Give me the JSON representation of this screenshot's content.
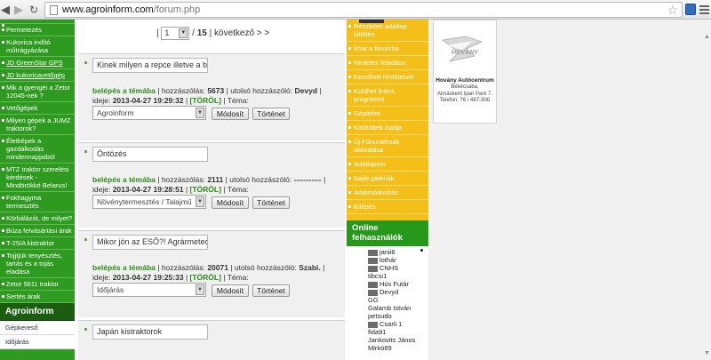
{
  "browser": {
    "url_domain": "www.agroinform.com",
    "url_path": "/forum.php"
  },
  "left_menu": {
    "items": [
      "Permetezés",
      "Kukorica indító műtrágyázása",
      "JD GreenStar GPS",
      "JD kukoricavetőgép",
      "Mik a gyengéi a Zetor 12045-nek ?",
      "Vetőgépek",
      "Milyen gépek a JUMZ traktorok?",
      "Életképek a gazdálkodás mindennapjaiból",
      "MTZ traktor szerelési kérdések - Mindörökké Belarus!",
      "Fokhagyma termesztés",
      "Körbálázót, de milyet?",
      "Búza felvásártási árak",
      "T-25/A kistraktor",
      "Tojjtjük tenyésztés, tartás és a tojás eladása",
      "Zetor 5611 traktor",
      "Sertés árak"
    ],
    "underlined": [
      "JD GreenStar GPS",
      "JD kukoricavetőgép"
    ],
    "section_title": "Agroinform",
    "sub_items": [
      "Gépkereső",
      "Időjárás"
    ]
  },
  "pager": {
    "page": "1",
    "total": "15",
    "next_label": "következő > >"
  },
  "topics": [
    {
      "title": "Kinek milyen a repce illetve a bú",
      "join": "belépés a témába",
      "replies_label": "hozzászólás:",
      "replies": "5673",
      "last_label": "utolsó hozzászóló:",
      "last_user": "Devyd",
      "date_label": "ideje:",
      "date": "2013-04-27 19:29:32",
      "delete": "[TÖRÖL]",
      "theme_label": "Téma:",
      "category": "Agroinform",
      "modify": "Módosít",
      "history": "Történet"
    },
    {
      "title": "Öntözés",
      "join": "belépés a témába",
      "replies_label": "hozzászólás:",
      "replies": "2111",
      "last_label": "utolsó hozzászóló:",
      "last_user": "-----------",
      "date_label": "ideje:",
      "date": "2013-04-27 19:28:51",
      "delete": "[TÖRÖL]",
      "theme_label": "Téma:",
      "category": "Növénytermesztés / Talajmű",
      "modify": "Módosít",
      "history": "Történet"
    },
    {
      "title": "Mikor jön az ESŐ?! Agrármeteon",
      "join": "belépés a témába",
      "replies_label": "hozzászólás:",
      "replies": "20071",
      "last_label": "utolsó hozzászóló:",
      "last_user": "Szabi.",
      "date_label": "ideje:",
      "date": "2013-04-27 19:25:33",
      "delete": "[TÖRÖL]",
      "theme_label": "Téma:",
      "category": "Időjárás",
      "modify": "Módosít",
      "history": "Történet"
    },
    {
      "title": "Japán kistraktorok"
    }
  ],
  "right_menu": {
    "items": [
      "Részletes adatlap kitöltés",
      "Írhat a fórumba",
      "Hirdetés feladása",
      "Kezelheti hirdetéseit",
      "Küldhet linket, programot",
      "Gépitélet",
      "Kitöltöttek listája",
      "Új Fórumtémák aktiválása",
      "Adatlapom",
      "Saját galériák",
      "Adatmódosítás",
      "Kilépés"
    ],
    "online_title": "Online felhasználók",
    "online_users": [
      {
        "name": "janii6",
        "avatar": true
      },
      {
        "name": "lothár",
        "avatar": true
      },
      {
        "name": "CNHS",
        "avatar": true
      },
      {
        "name": "tibcsi1",
        "avatar": false
      },
      {
        "name": "Hús Futár",
        "avatar": true
      },
      {
        "name": "Devyd",
        "avatar": true
      },
      {
        "name": "GG",
        "avatar": false
      },
      {
        "name": "Galamb István",
        "avatar": false
      },
      {
        "name": "petsudo",
        "avatar": false
      },
      {
        "name": "Csarli 1",
        "avatar": true
      },
      {
        "name": "fida91",
        "avatar": false
      },
      {
        "name": "Jankovits János",
        "avatar": false
      },
      {
        "name": "Mirkó89",
        "avatar": false
      }
    ]
  },
  "ad": {
    "logo_text": "HOVÁNY",
    "company": "Hovány Autócentrum",
    "city": "Békécsaba,",
    "address": "Almáskerti Ipari Park 7.",
    "phone": "Telefon: 76 / 487-300"
  },
  "colors": {
    "green": "#2e9a1f",
    "dark_green": "#1b5e10",
    "yellow": "#f5bf1a",
    "link_green": "#2e8a1d"
  }
}
